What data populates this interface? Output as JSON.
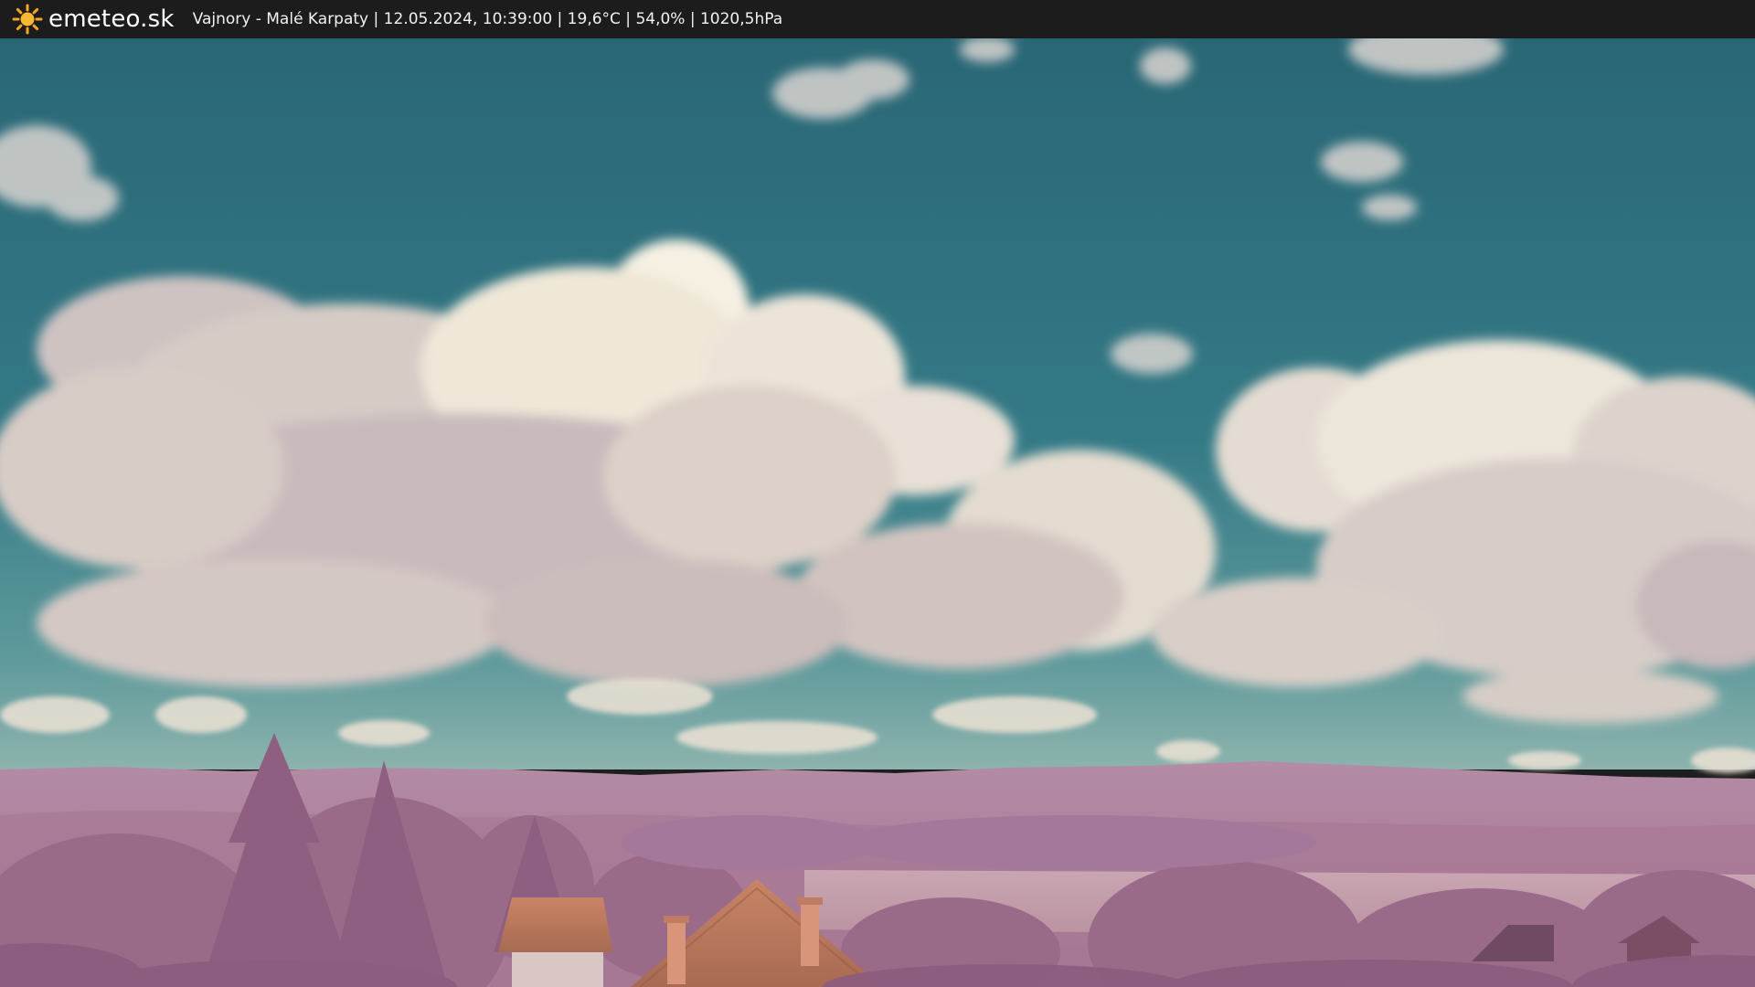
{
  "overlay": {
    "brand": "emeteo.sk",
    "logo_icon": "sun-icon",
    "caption": "Vajnory - Malé Karpaty | 12.05.2024, 10:39:00 | 19,6°C | 54,0% | 1020,5hPa",
    "logo_color": "#f5a623",
    "bar_color": "#1c1c1c"
  },
  "scene": {
    "sky_color": "#2f6f7a",
    "cloud_color": "#e9e2d6",
    "hills_color": "#a77a99",
    "foliage_color": "#9c6c8c",
    "roof_color": "#b9775e"
  }
}
